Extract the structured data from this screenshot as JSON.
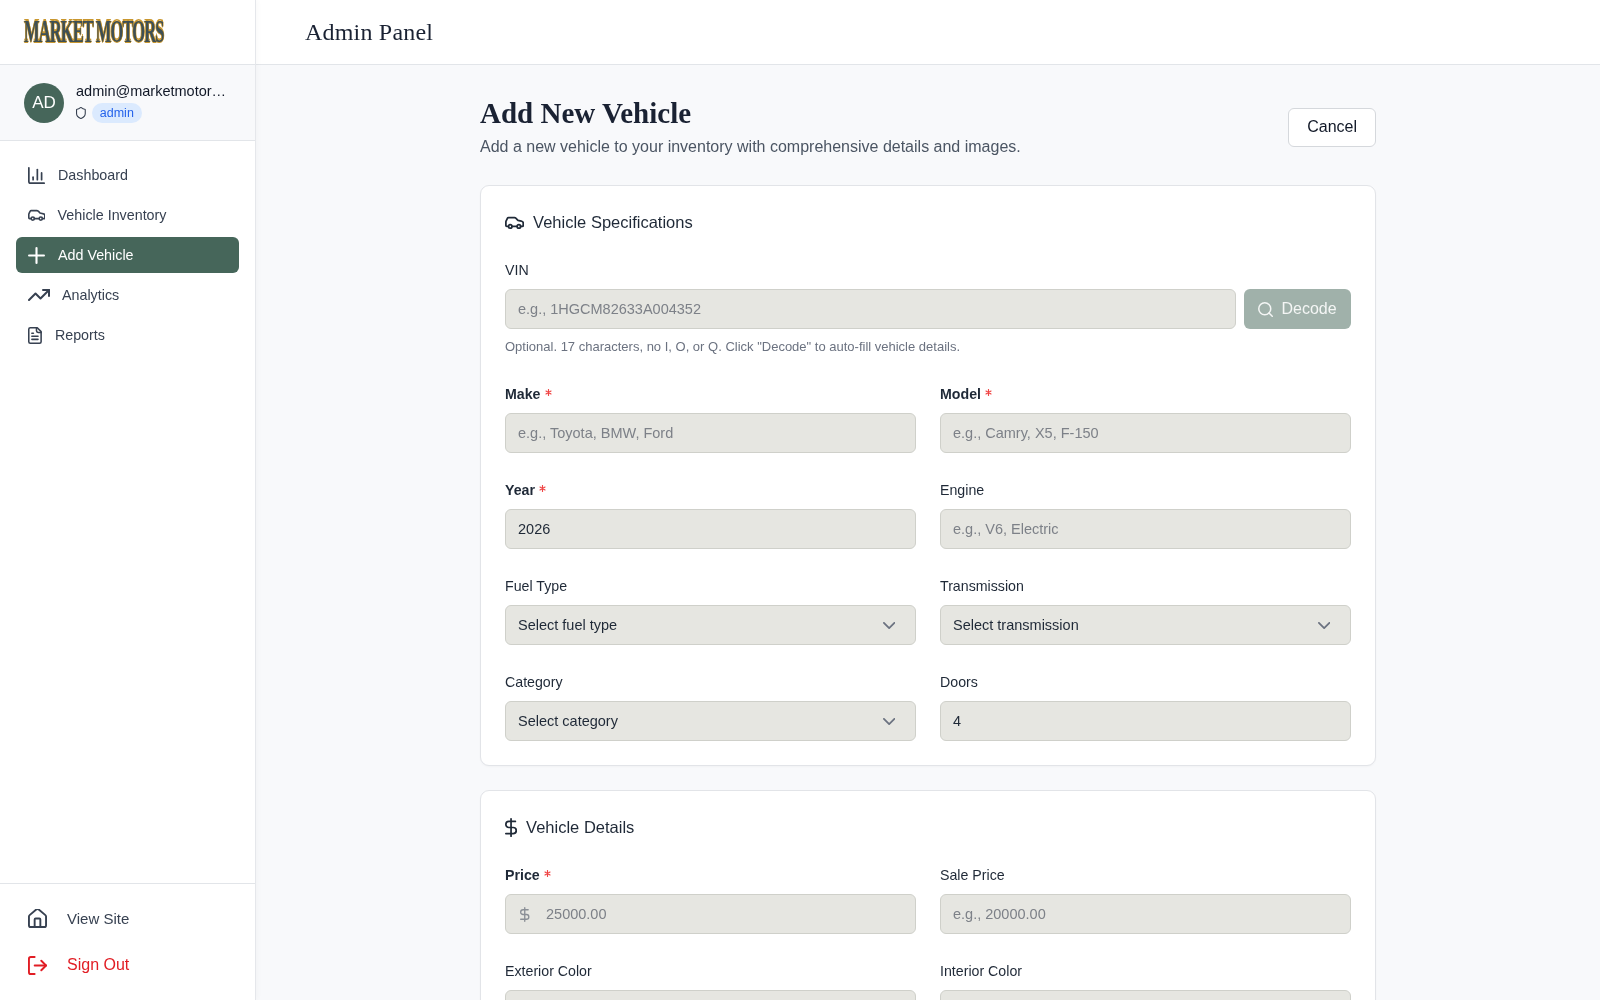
{
  "brand": {
    "logo": "MARKET MOTORS"
  },
  "header": {
    "title": "Admin Panel"
  },
  "user": {
    "initials": "AD",
    "email": "admin@marketmotor…",
    "role": "admin"
  },
  "sidebar": {
    "items": [
      {
        "label": "Dashboard",
        "selected": false
      },
      {
        "label": "Vehicle Inventory",
        "selected": false
      },
      {
        "label": "Add Vehicle",
        "selected": true
      },
      {
        "label": "Analytics",
        "selected": false
      },
      {
        "label": "Reports",
        "selected": false
      }
    ],
    "footer": [
      {
        "label": "View Site",
        "kind": "link"
      },
      {
        "label": "Sign Out",
        "kind": "danger"
      }
    ]
  },
  "page": {
    "title": "Add New Vehicle",
    "subtitle": "Add a new vehicle to your inventory with comprehensive details and images.",
    "cancel_button": "Cancel"
  },
  "sections": [
    {
      "title": "Vehicle Specifications",
      "fields": [
        {
          "kind": "vin",
          "label": "VIN",
          "required": false,
          "placeholder": "e.g., 1HGCM82633A004352",
          "button": {
            "label": "Decode",
            "disabled": true
          },
          "hint": "Optional. 17 characters, no I, O, or Q. Click \"Decode\" to auto-fill vehicle details."
        },
        {
          "kind": "text",
          "label": "Make",
          "required": true,
          "placeholder": "e.g., Toyota, BMW, Ford"
        },
        {
          "kind": "text",
          "label": "Model",
          "required": true,
          "placeholder": "e.g., Camry, X5, F-150"
        },
        {
          "kind": "text",
          "label": "Year",
          "required": true,
          "value": "2026"
        },
        {
          "kind": "text",
          "label": "Engine",
          "required": false,
          "placeholder": "e.g., V6, Electric"
        },
        {
          "kind": "select",
          "label": "Fuel Type",
          "required": false,
          "value": "Select fuel type"
        },
        {
          "kind": "select",
          "label": "Transmission",
          "required": false,
          "value": "Select transmission"
        },
        {
          "kind": "select",
          "label": "Category",
          "required": false,
          "value": "Select category"
        },
        {
          "kind": "text",
          "label": "Doors",
          "required": false,
          "value": "4"
        }
      ]
    },
    {
      "title": "Vehicle Details",
      "fields": [
        {
          "kind": "currency",
          "label": "Price",
          "required": true,
          "placeholder": "25000.00"
        },
        {
          "kind": "text",
          "label": "Sale Price",
          "required": false,
          "placeholder": "e.g., 20000.00"
        },
        {
          "kind": "text",
          "label": "Exterior Color",
          "required": false
        },
        {
          "kind": "text",
          "label": "Interior Color",
          "required": false
        }
      ]
    }
  ]
}
